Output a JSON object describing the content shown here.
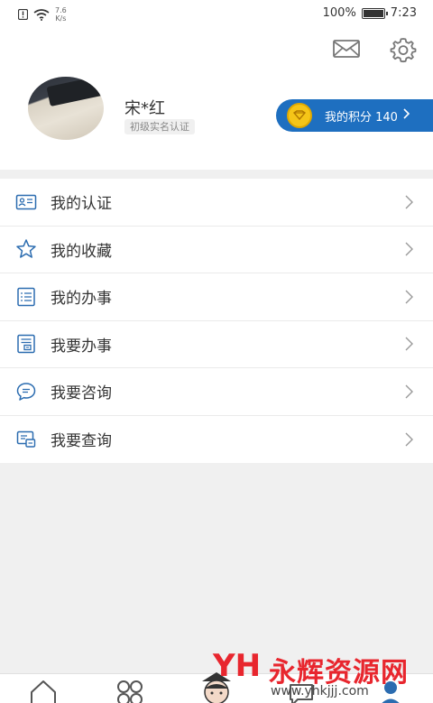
{
  "status_bar": {
    "net_speed_value": "7.6",
    "net_speed_unit": "K/s",
    "battery_percent": "100%",
    "time": "7:23"
  },
  "profile": {
    "name": "宋*红",
    "verification_badge": "初级实名认证"
  },
  "points": {
    "label": "我的积分 140"
  },
  "menu": {
    "items": [
      {
        "label": "我的认证",
        "icon": "id-card-icon"
      },
      {
        "label": "我的收藏",
        "icon": "star-icon"
      },
      {
        "label": "我的办事",
        "icon": "task-list-icon"
      },
      {
        "label": "我要办事",
        "icon": "form-icon"
      },
      {
        "label": "我要咨询",
        "icon": "chat-bubble-icon"
      },
      {
        "label": "我要查询",
        "icon": "query-icon"
      }
    ]
  },
  "bottom_nav": {
    "items": [
      "home-icon",
      "apps-grid-icon",
      "assistant-icon",
      "messages-icon",
      "profile-icon"
    ]
  },
  "watermark": {
    "logo": "YH",
    "title": "永辉资源网",
    "url": "www.yhkjjj.com"
  },
  "colors": {
    "accent": "#1e6fc0",
    "icon_blue": "#2b6cb0",
    "coin": "#f5c518",
    "watermark": "#e8262e"
  }
}
